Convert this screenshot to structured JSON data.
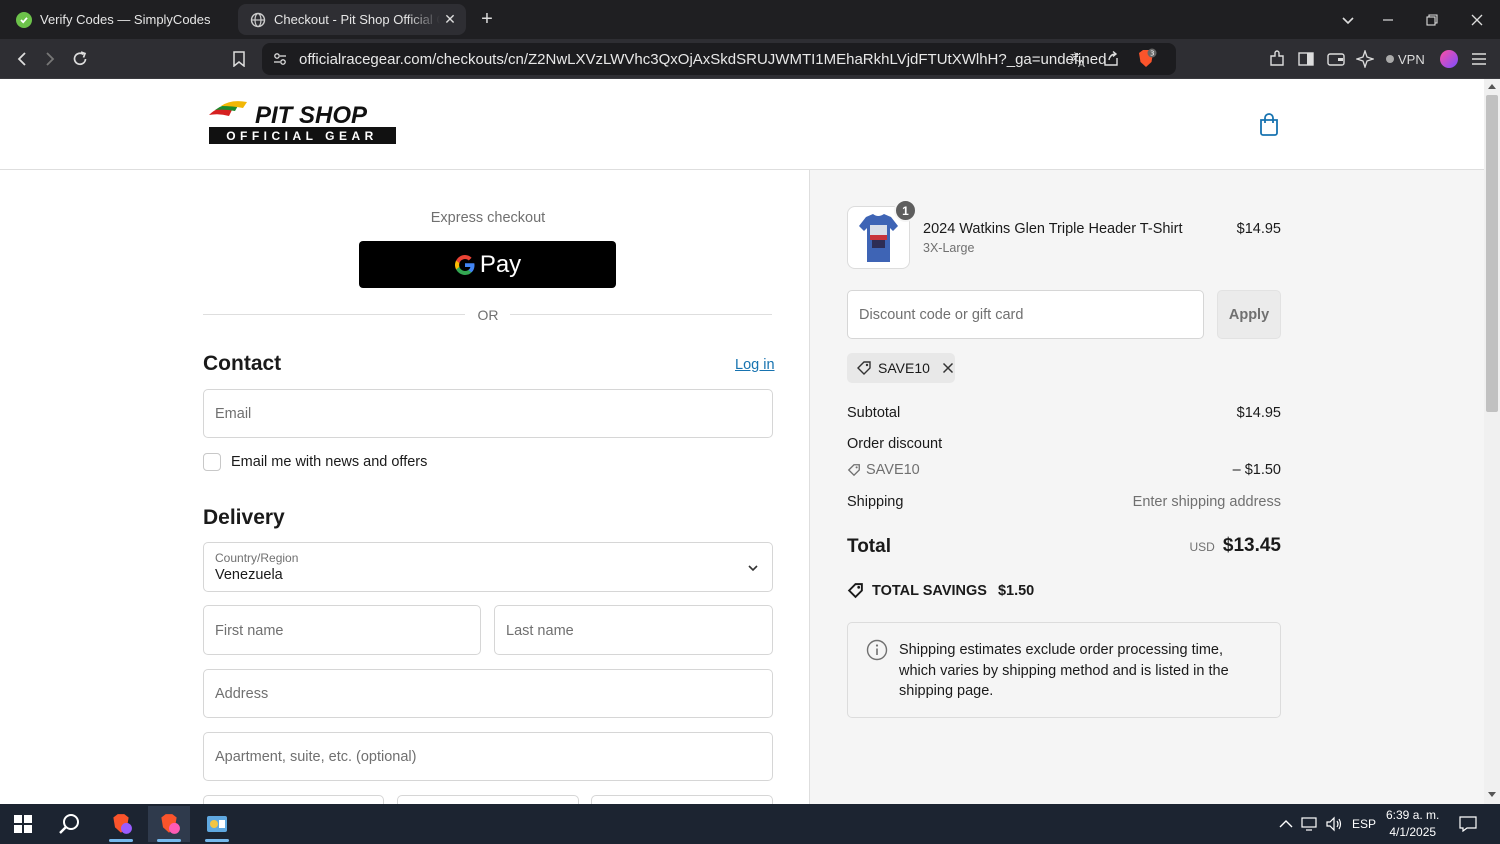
{
  "browser": {
    "tabs": [
      {
        "title": "Verify Codes — SimplyCodes",
        "active": false
      },
      {
        "title": "Checkout - Pit Shop Official Gear",
        "active": true
      }
    ],
    "url": "officialracegear.com/checkouts/cn/Z2NwLXVzLWVhc3QxOjAxSkdSRUJWMTI1MEhaRkhLVjdFTUtXWlhH?_ga=undefined",
    "brave_badge": "3",
    "vpn_label": "VPN",
    "accent": "#1773b0"
  },
  "store": {
    "logo_line1": "PIT SHOP",
    "logo_line2": "OFFICIAL GEAR"
  },
  "checkout": {
    "express_label": "Express checkout",
    "gpay_label": "Pay",
    "or_label": "OR",
    "contact_title": "Contact",
    "login_link": "Log in",
    "email_placeholder": "Email",
    "newsletter_label": "Email me with news and offers",
    "delivery_title": "Delivery",
    "country_label": "Country/Region",
    "country_value": "Venezuela",
    "first_name_placeholder": "First name",
    "last_name_placeholder": "Last name",
    "address_placeholder": "Address",
    "apartment_placeholder": "Apartment, suite, etc. (optional)"
  },
  "summary": {
    "item_qty": "1",
    "item_name": "2024 Watkins Glen Triple Header T-Shirt",
    "item_variant": "3X-Large",
    "item_price": "$14.95",
    "discount_placeholder": "Discount code or gift card",
    "apply_label": "Apply",
    "applied_code": "SAVE10",
    "subtotal_label": "Subtotal",
    "subtotal_value": "$14.95",
    "order_discount_label": "Order discount",
    "discount_code": "SAVE10",
    "discount_value": "– $1.50",
    "shipping_label": "Shipping",
    "shipping_value": "Enter shipping address",
    "total_label": "Total",
    "total_currency": "USD",
    "total_value": "$13.45",
    "savings_label": "TOTAL SAVINGS",
    "savings_value": "$1.50",
    "info_text": "Shipping estimates exclude order processing time, which varies by shipping method and is listed in the shipping page."
  },
  "taskbar": {
    "language": "ESP",
    "time": "6:39 a. m.",
    "date": "4/1/2025"
  }
}
